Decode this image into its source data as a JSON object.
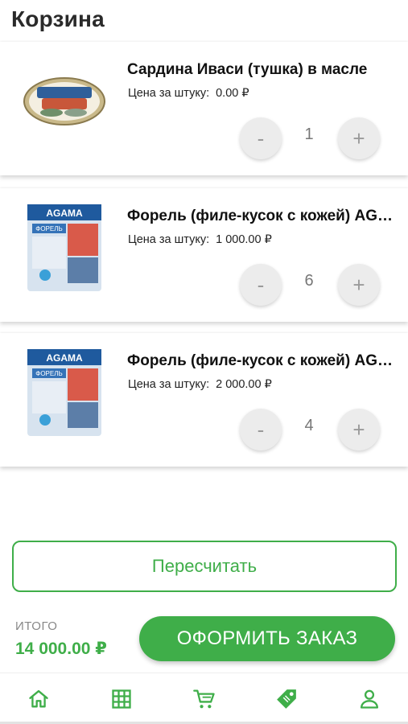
{
  "header": {
    "title": "Корзина"
  },
  "cart": {
    "price_label": "Цена за штуку:",
    "items": [
      {
        "name": "Сардина Иваси (тушка) в масле",
        "price": "0.00 ₽",
        "quantity": "1",
        "image": "canned-sardine-product-image"
      },
      {
        "name": "Форель (филе-кусок с кожей) AGAMA",
        "price": "1 000.00 ₽",
        "quantity": "6",
        "image": "trout-fillet-pack-image",
        "brand": "AGAMA",
        "pack_label": "ФОРЕЛЬ"
      },
      {
        "name": "Форель (филе-кусок с кожей) AGAMA",
        "price": "2 000.00 ₽",
        "quantity": "4",
        "image": "trout-fillet-pack-image",
        "brand": "AGAMA",
        "pack_label": "ФОРЕЛЬ"
      }
    ],
    "minus_symbol": "-",
    "plus_symbol": "+"
  },
  "actions": {
    "recalc_label": "Пересчитать",
    "checkout_label": "ОФОРМИТЬ ЗАКАЗ"
  },
  "summary": {
    "total_label": "ИТОГО",
    "total_value": "14 000.00 ₽"
  },
  "nav": {
    "items": [
      {
        "icon": "home-icon"
      },
      {
        "icon": "catalog-grid-icon"
      },
      {
        "icon": "cart-icon"
      },
      {
        "icon": "tag-icon"
      },
      {
        "icon": "profile-icon"
      }
    ]
  },
  "colors": {
    "accent": "#3fae49",
    "stepper_bg": "#ececec",
    "muted_text": "#888888"
  }
}
